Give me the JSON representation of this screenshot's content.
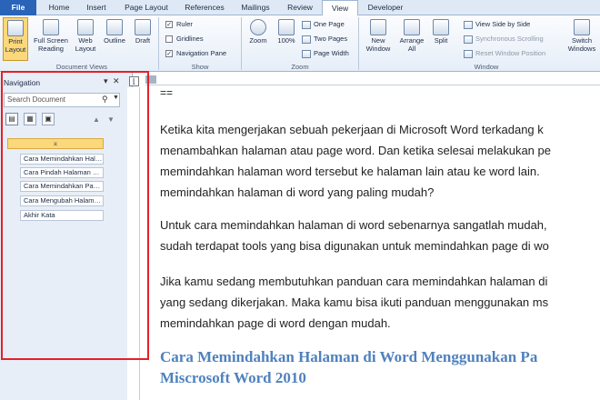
{
  "tabs": [
    "File",
    "Home",
    "Insert",
    "Page Layout",
    "References",
    "Mailings",
    "Review",
    "View",
    "Developer"
  ],
  "ribbon": {
    "document_views": {
      "label": "Document Views",
      "print_layout": "Print Layout",
      "full_screen_reading": "Full Screen Reading",
      "web_layout": "Web Layout",
      "outline": "Outline",
      "draft": "Draft"
    },
    "show": {
      "label": "Show",
      "ruler": "Ruler",
      "gridlines": "Gridlines",
      "navigation_pane": "Navigation Pane"
    },
    "zoom": {
      "label": "Zoom",
      "zoom": "Zoom",
      "percent": "100%",
      "one_page": "One Page",
      "two_pages": "Two Pages",
      "page_width": "Page Width"
    },
    "window": {
      "label": "Window",
      "new_window": "New Window",
      "arrange_all": "Arrange All",
      "split": "Split",
      "view_side_by_side": "View Side by Side",
      "synchronous_scrolling": "Synchronous Scrolling",
      "reset_window_position": "Reset Window Position",
      "switch_windows": "Switch Windows"
    }
  },
  "nav": {
    "title": "Navigation",
    "search_placeholder": "Search Document",
    "headings": [
      "Cara Memindahkan Halaman di Word Menggunakan Pane",
      "Cara Pindah Halaman di Word",
      "Cara Memindahkan Page di Word",
      "Cara Mengubah Halaman di Word",
      "Akhir Kata"
    ]
  },
  "doc": {
    "marker": "==",
    "para1": [
      "Ketika kita mengerjakan sebuah pekerjaan di Microsoft Word terkadang k",
      "menambahkan halaman atau page word. Dan ketika selesai melakukan pe",
      "memindahkan halaman word tersebut ke halaman lain atau ke word lain.",
      "memindahkan halaman di word yang paling mudah?"
    ],
    "para2": [
      "Untuk cara memindahkan halaman di word sebenarnya sangatlah mudah,",
      "sudah terdapat tools yang bisa digunakan untuk memindahkan page di wo"
    ],
    "para3": [
      "Jika kamu sedang membutuhkan panduan cara memindahkan halaman di",
      "yang sedang dikerjakan. Maka kamu bisa ikuti panduan menggunakan ms",
      "memindahkan page di word dengan mudah."
    ],
    "heading": [
      "Cara Memindahkan Halaman di Word Menggunakan Pa",
      "Miscrosoft Word 2010"
    ]
  }
}
